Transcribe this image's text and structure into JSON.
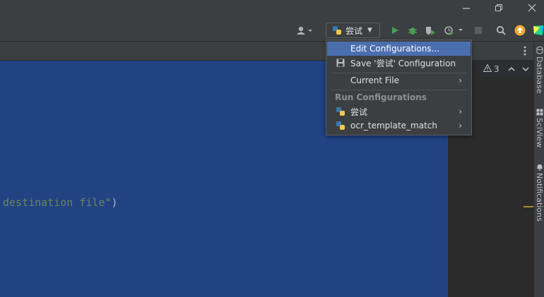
{
  "window": {
    "minimize_icon": "minimize-icon",
    "restore_icon": "restore-icon",
    "close_icon": "close-icon"
  },
  "toolbar": {
    "run_config_selected": "尝试",
    "icons": [
      "user-icon",
      "run-icon",
      "debug-icon",
      "coverage-icon",
      "profile-icon",
      "stop-icon",
      "search-icon",
      "update-icon",
      "jetbrains-icon"
    ]
  },
  "editor": {
    "code_text": "destination file\"",
    "code_paren": ")",
    "inspection_count": "3"
  },
  "right_sidebar": {
    "tabs": [
      "Database",
      "SciView",
      "Notifications"
    ]
  },
  "run_menu": {
    "items": [
      {
        "label": "Edit Configurations...",
        "selected": true
      },
      {
        "label": "Save '尝试' Configuration",
        "icon": "save-icon"
      },
      {
        "label": "Current File",
        "has_submenu": true
      }
    ],
    "group_header": "Run Configurations",
    "configs": [
      {
        "label": "尝试",
        "icon": "python-icon",
        "has_submenu": true
      },
      {
        "label": "ocr_template_match",
        "icon": "python-icon",
        "has_submenu": true
      }
    ]
  },
  "colors": {
    "editor_selection": "#214283",
    "menu_selection": "#4b6eaf",
    "run_green": "#499c54"
  }
}
